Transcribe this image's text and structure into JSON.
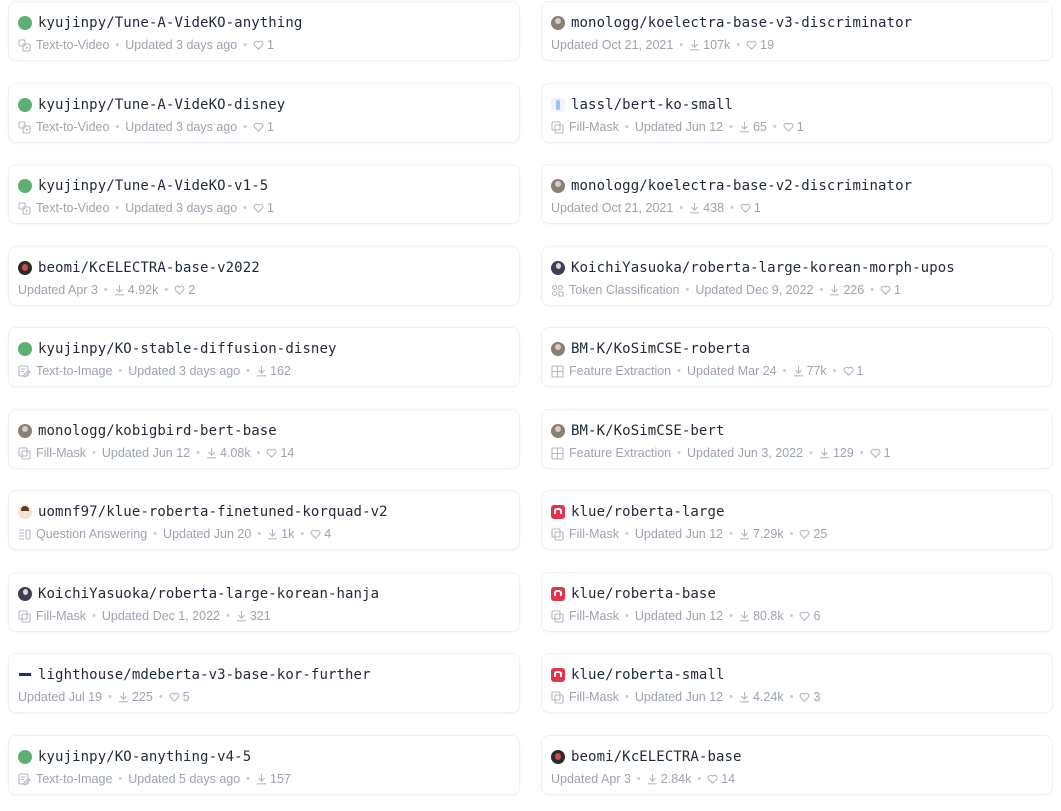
{
  "models": [
    {
      "name": "kyujinpy/Tune-A-VideKO-anything",
      "avatar": "green",
      "task": "Text-to-Video",
      "task_icon": "text-to-video-icon",
      "updated": "Updated 3 days ago",
      "downloads": "",
      "likes": "1"
    },
    {
      "name": "monologg/koelectra-base-v3-discriminator",
      "avatar": "photo",
      "task": "",
      "task_icon": "",
      "updated": "Updated Oct 21, 2021",
      "downloads": "107k",
      "likes": "19"
    },
    {
      "name": "kyujinpy/Tune-A-VideKO-disney",
      "avatar": "green",
      "task": "Text-to-Video",
      "task_icon": "text-to-video-icon",
      "updated": "Updated 3 days ago",
      "downloads": "",
      "likes": "1"
    },
    {
      "name": "lassl/bert-ko-small",
      "avatar": "light",
      "task": "Fill-Mask",
      "task_icon": "fill-mask-icon",
      "updated": "Updated Jun 12",
      "downloads": "65",
      "likes": "1"
    },
    {
      "name": "kyujinpy/Tune-A-VideKO-v1-5",
      "avatar": "green",
      "task": "Text-to-Video",
      "task_icon": "text-to-video-icon",
      "updated": "Updated 3 days ago",
      "downloads": "",
      "likes": "1"
    },
    {
      "name": "monologg/koelectra-base-v2-discriminator",
      "avatar": "photo",
      "task": "",
      "task_icon": "",
      "updated": "Updated Oct 21, 2021",
      "downloads": "438",
      "likes": "1"
    },
    {
      "name": "beomi/KcELECTRA-base-v2022",
      "avatar": "dark",
      "task": "",
      "task_icon": "",
      "updated": "Updated Apr 3",
      "downloads": "4.92k",
      "likes": "2"
    },
    {
      "name": "KoichiYasuoka/roberta-large-korean-morph-upos",
      "avatar": "person",
      "task": "Token Classification",
      "task_icon": "token-classification-icon",
      "updated": "Updated Dec 9, 2022",
      "downloads": "226",
      "likes": "1"
    },
    {
      "name": "kyujinpy/KO-stable-diffusion-disney",
      "avatar": "green",
      "task": "Text-to-Image",
      "task_icon": "text-to-image-icon",
      "updated": "Updated 3 days ago",
      "downloads": "162",
      "likes": ""
    },
    {
      "name": "BM-K/KoSimCSE-roberta",
      "avatar": "photo",
      "task": "Feature Extraction",
      "task_icon": "feature-extraction-icon",
      "updated": "Updated Mar 24",
      "downloads": "77k",
      "likes": "1"
    },
    {
      "name": "monologg/kobigbird-bert-base",
      "avatar": "photo",
      "task": "Fill-Mask",
      "task_icon": "fill-mask-icon",
      "updated": "Updated Jun 12",
      "downloads": "4.08k",
      "likes": "14"
    },
    {
      "name": "BM-K/KoSimCSE-bert",
      "avatar": "photo",
      "task": "Feature Extraction",
      "task_icon": "feature-extraction-icon",
      "updated": "Updated Jun 3, 2022",
      "downloads": "129",
      "likes": "1"
    },
    {
      "name": "uomnf97/klue-roberta-finetuned-korquad-v2",
      "avatar": "face",
      "task": "Question Answering",
      "task_icon": "question-answering-icon",
      "updated": "Updated Jun 20",
      "downloads": "1k",
      "likes": "4"
    },
    {
      "name": "klue/roberta-large",
      "avatar": "klue",
      "task": "Fill-Mask",
      "task_icon": "fill-mask-icon",
      "updated": "Updated Jun 12",
      "downloads": "7.29k",
      "likes": "25"
    },
    {
      "name": "KoichiYasuoka/roberta-large-korean-hanja",
      "avatar": "person",
      "task": "Fill-Mask",
      "task_icon": "fill-mask-icon",
      "updated": "Updated Dec 1, 2022",
      "downloads": "321",
      "likes": ""
    },
    {
      "name": "klue/roberta-base",
      "avatar": "klue",
      "task": "Fill-Mask",
      "task_icon": "fill-mask-icon",
      "updated": "Updated Jun 12",
      "downloads": "80.8k",
      "likes": "6"
    },
    {
      "name": "lighthouse/mdeberta-v3-base-kor-further",
      "avatar": "lighthouse",
      "task": "",
      "task_icon": "",
      "updated": "Updated Jul 19",
      "downloads": "225",
      "likes": "5"
    },
    {
      "name": "klue/roberta-small",
      "avatar": "klue",
      "task": "Fill-Mask",
      "task_icon": "fill-mask-icon",
      "updated": "Updated Jun 12",
      "downloads": "4.24k",
      "likes": "3"
    },
    {
      "name": "kyujinpy/KO-anything-v4-5",
      "avatar": "green",
      "task": "Text-to-Image",
      "task_icon": "text-to-image-icon",
      "updated": "Updated 5 days ago",
      "downloads": "157",
      "likes": ""
    },
    {
      "name": "beomi/KcELECTRA-base",
      "avatar": "dark",
      "task": "",
      "task_icon": "",
      "updated": "Updated Apr 3",
      "downloads": "2.84k",
      "likes": "14"
    }
  ],
  "icons": {
    "downloads": "download-icon",
    "likes": "heart-icon"
  },
  "colors": {
    "title": "#1f2937",
    "meta": "#9ca3af",
    "border": "#eef0f3"
  }
}
